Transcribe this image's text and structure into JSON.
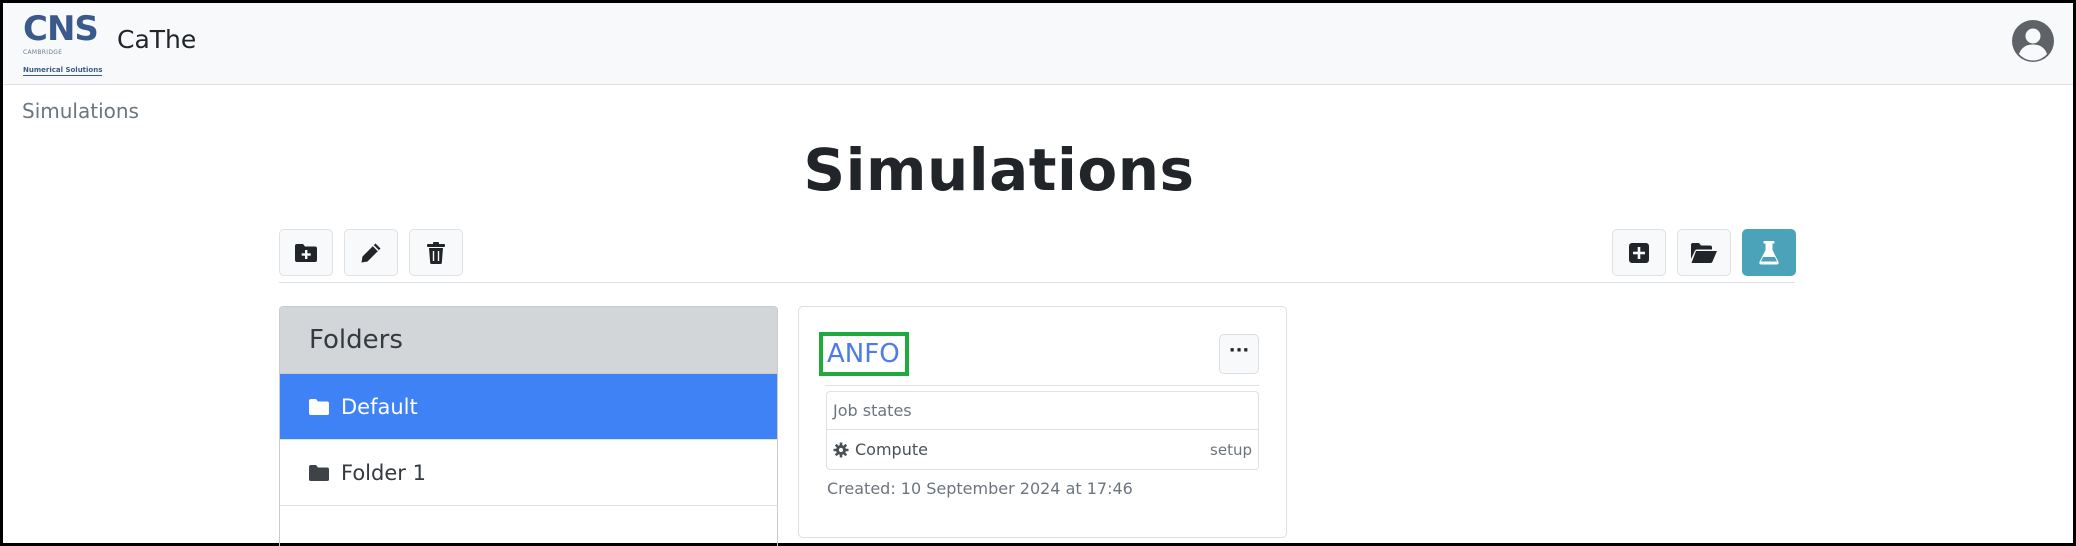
{
  "navbar": {
    "logo": {
      "main": "CNS",
      "line1": "CAMBRIDGE",
      "line2": "Numerical Solutions"
    },
    "brand": "CaThe",
    "user_icon": "user-circle-icon"
  },
  "breadcrumb": "Simulations",
  "page_title": "Simulations",
  "toolbar": {
    "left": [
      {
        "icon": "folder-plus-icon"
      },
      {
        "icon": "pencil-icon"
      },
      {
        "icon": "trash-icon"
      }
    ],
    "right": [
      {
        "icon": "plus-square-icon"
      },
      {
        "icon": "folder-open-icon"
      },
      {
        "icon": "flask-icon"
      }
    ],
    "accent": "#4aa3b8"
  },
  "folders": {
    "heading": "Folders",
    "items": [
      {
        "label": "Default",
        "active": true
      },
      {
        "label": "Folder 1",
        "active": false
      }
    ],
    "active_color": "#3f82f6"
  },
  "simulation_card": {
    "name": "ANFO",
    "more_label": "···",
    "job_states_label": "Job states",
    "job": {
      "label": "Compute",
      "status": "setup"
    },
    "created": "Created: 10 September 2024 at 17:46",
    "highlight_color": "#1faa3c"
  }
}
